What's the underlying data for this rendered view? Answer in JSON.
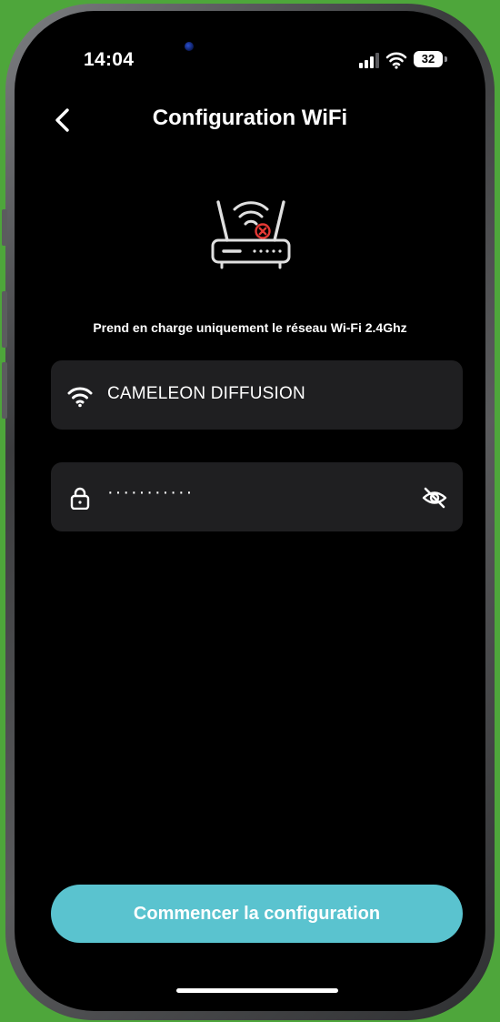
{
  "status_bar": {
    "time": "14:04",
    "battery": "32",
    "icons": [
      "signal-icon",
      "wifi-icon",
      "battery-icon"
    ]
  },
  "header": {
    "back_icon": "chevron-left-icon",
    "title": "Configuration WiFi"
  },
  "illustration": {
    "icon": "router-wifi-error-icon",
    "error_color": "#e53935"
  },
  "info_text": "Prend en charge uniquement le réseau Wi-Fi 2.4Ghz",
  "ssid_field": {
    "icon": "wifi-icon",
    "value": "CAMELEON DIFFUSION"
  },
  "password_field": {
    "icon": "lock-icon",
    "value": "···········",
    "toggle_icon": "eye-off-icon"
  },
  "start_button": {
    "label": "Commencer la configuration",
    "color": "#5ac3cf"
  },
  "colors": {
    "background": "#000000",
    "field_background": "#1f1f21",
    "accent": "#5ac3cf"
  }
}
